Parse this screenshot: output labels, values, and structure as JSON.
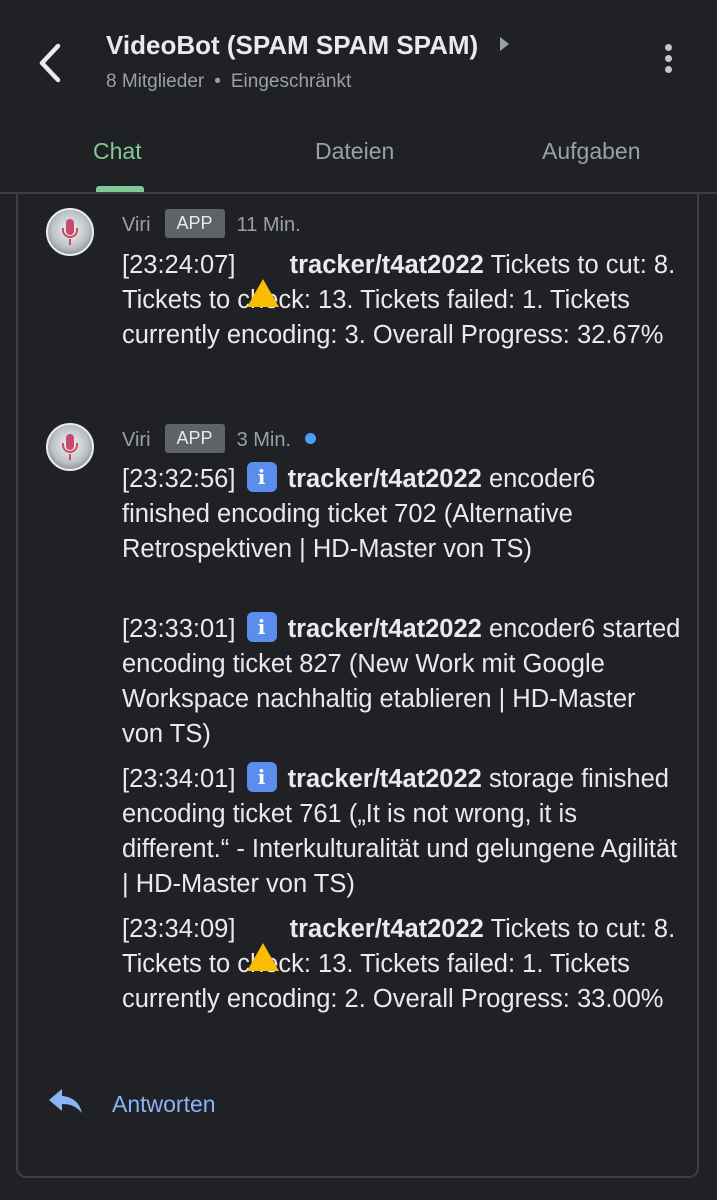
{
  "header": {
    "title": "VideoBot (SPAM SPAM SPAM)",
    "members": "8 Mitglieder",
    "separator": "•",
    "restriction": "Eingeschränkt"
  },
  "tabs": [
    {
      "label": "Chat",
      "active": true
    },
    {
      "label": "Dateien",
      "active": false
    },
    {
      "label": "Aufgaben",
      "active": false
    }
  ],
  "colors": {
    "accent": "#81c995",
    "link": "#8ab4f8",
    "unread": "#4a9ff5",
    "warning": "#fbbc04",
    "info": "#5b8def"
  },
  "messages": [
    {
      "sender": "Viri",
      "badge": "APP",
      "time": "11 Min.",
      "unread": false,
      "entries": [
        {
          "time": "[23:24:07]",
          "icon": "warning-icon",
          "project": "tracker/t4at2022",
          "body": " Tickets to cut: 8. Tickets to check: 13. Tickets failed: 1. Tickets currently encoding: 3. Overall Progress: 32.67%"
        }
      ]
    },
    {
      "sender": "Viri",
      "badge": "APP",
      "time": "3 Min.",
      "unread": true,
      "entries": [
        {
          "time": "[23:32:56]",
          "icon": "info-icon",
          "project": "tracker/t4at2022",
          "body": " encoder6 finished encoding ticket 702 (Alternative Retrospektiven | HD-Master von TS)"
        },
        {
          "time": "[23:33:01]",
          "icon": "info-icon",
          "project": "tracker/t4at2022",
          "body": " encoder6 started encoding ticket 827 (New Work mit Google Workspace nachhaltig etablieren | HD-Master von TS)"
        },
        {
          "time": "[23:34:01]",
          "icon": "info-icon",
          "project": "tracker/t4at2022",
          "body": " storage finished encoding ticket 761 („It is not wrong, it is different.“ - Interkulturalität und gelungene Agilität | HD-Master von TS)"
        },
        {
          "time": "[23:34:09]",
          "icon": "warning-icon",
          "project": "tracker/t4at2022",
          "body": " Tickets to cut: 8. Tickets to check: 13. Tickets failed: 1. Tickets currently encoding: 2. Overall Progress: 33.00%"
        }
      ]
    }
  ],
  "reply": {
    "label": "Antworten",
    "icon": "reply-arrow-icon"
  }
}
